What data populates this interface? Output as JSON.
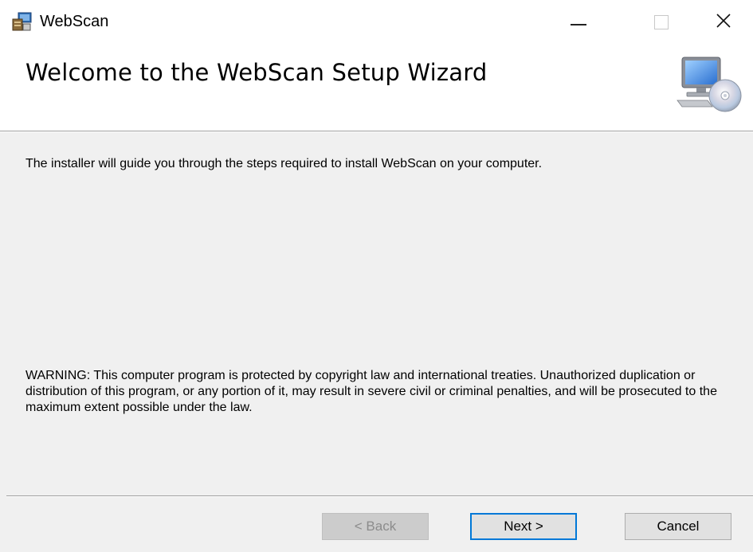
{
  "window": {
    "title": "WebScan",
    "icons": {
      "app": "installer-icon",
      "minimize": "minimize-icon",
      "maximize": "maximize-icon",
      "close": "close-icon"
    },
    "close_glyph": "✕"
  },
  "header": {
    "title": "Welcome to the WebScan Setup Wizard",
    "image": "computer-cd-icon"
  },
  "body": {
    "intro": "The installer will guide you through the steps required to install WebScan on your computer.",
    "warning": "WARNING: This computer program is protected by copyright law and international treaties. Unauthorized duplication or distribution of this program, or any portion of it, may result in severe civil or criminal penalties, and will be prosecuted to the maximum extent possible under the law."
  },
  "buttons": {
    "back_label": "< Back",
    "next_label": "Next >",
    "cancel_label": "Cancel",
    "back_enabled": false,
    "default_button": "next"
  },
  "colors": {
    "panel_bg": "#f0f0f0",
    "focus_border": "#0078d7",
    "disabled_text": "#8c8c8c"
  }
}
